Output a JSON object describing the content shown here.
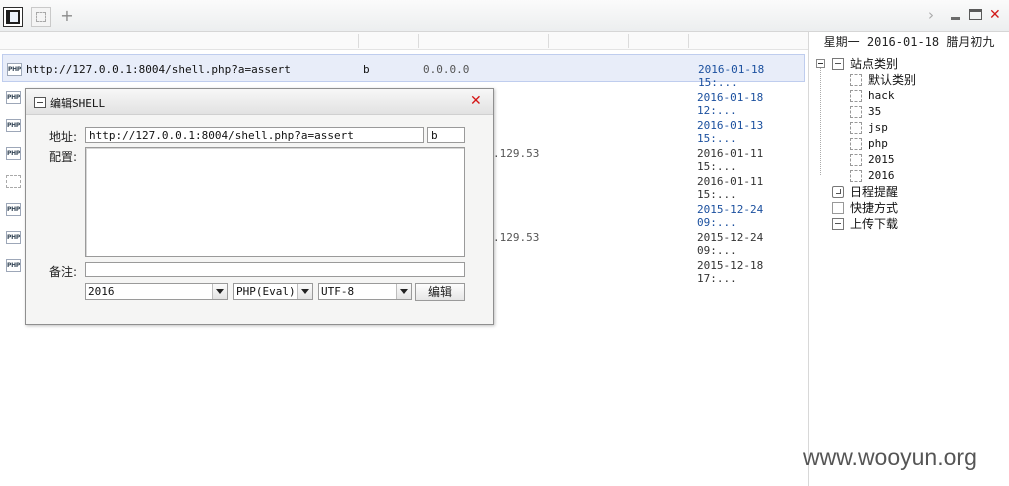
{
  "window": {
    "tab_add": "+",
    "nav_arrow": "›",
    "close_glyph": "✕"
  },
  "shells": [
    {
      "icon": "PHP",
      "url": "http://127.0.0.1:8004/shell.php?a=assert",
      "password": "b",
      "ip": "0.0.0.0",
      "time": "2016-01-18 15:...",
      "selected": true
    },
    {
      "icon": "PHP",
      "url": "",
      "password": "",
      "ip": "",
      "time": "2016-01-18 12:..."
    },
    {
      "icon": "PHP",
      "url": "",
      "password": "",
      "ip": "",
      "time": "2016-01-13 15:..."
    },
    {
      "icon": "PHP",
      "url": "",
      "password": "",
      "ip": ".129.53",
      "time": "2016-01-11 15:..."
    },
    {
      "icon": "",
      "url": "",
      "password": "",
      "ip": "",
      "time": "2016-01-11 15:..."
    },
    {
      "icon": "PHP",
      "url": "",
      "password": "",
      "ip": "",
      "time": "2015-12-24 09:..."
    },
    {
      "icon": "PHP",
      "url": "",
      "password": "",
      "ip": ".129.53",
      "time": "2015-12-24 09:..."
    },
    {
      "icon": "PHP",
      "url": "",
      "password": "",
      "ip": "",
      "time": "2015-12-18 17:..."
    }
  ],
  "right_panel": {
    "date": "星期一 2016-01-18 腊月初九",
    "tree": {
      "sites": "站点类别",
      "categories": [
        "默认类别",
        "hack",
        "35",
        "jsp",
        "php",
        "2015",
        "2016"
      ],
      "schedule": "日程提醒",
      "shortcuts": "快捷方式",
      "transfer": "上传下载"
    }
  },
  "dialog": {
    "title": "编辑SHELL",
    "close_glyph": "✕",
    "address_label": "地址:",
    "address_value": "http://127.0.0.1:8004/shell.php?a=assert",
    "password_value": "b",
    "config_label": "配置:",
    "config_value": "",
    "note_label": "备注:",
    "note_value": "",
    "category_value": "2016",
    "script_type_value": "PHP(Eval)",
    "encoding_value": "UTF-8",
    "edit_button": "编辑"
  },
  "watermark": "www.wooyun.org"
}
